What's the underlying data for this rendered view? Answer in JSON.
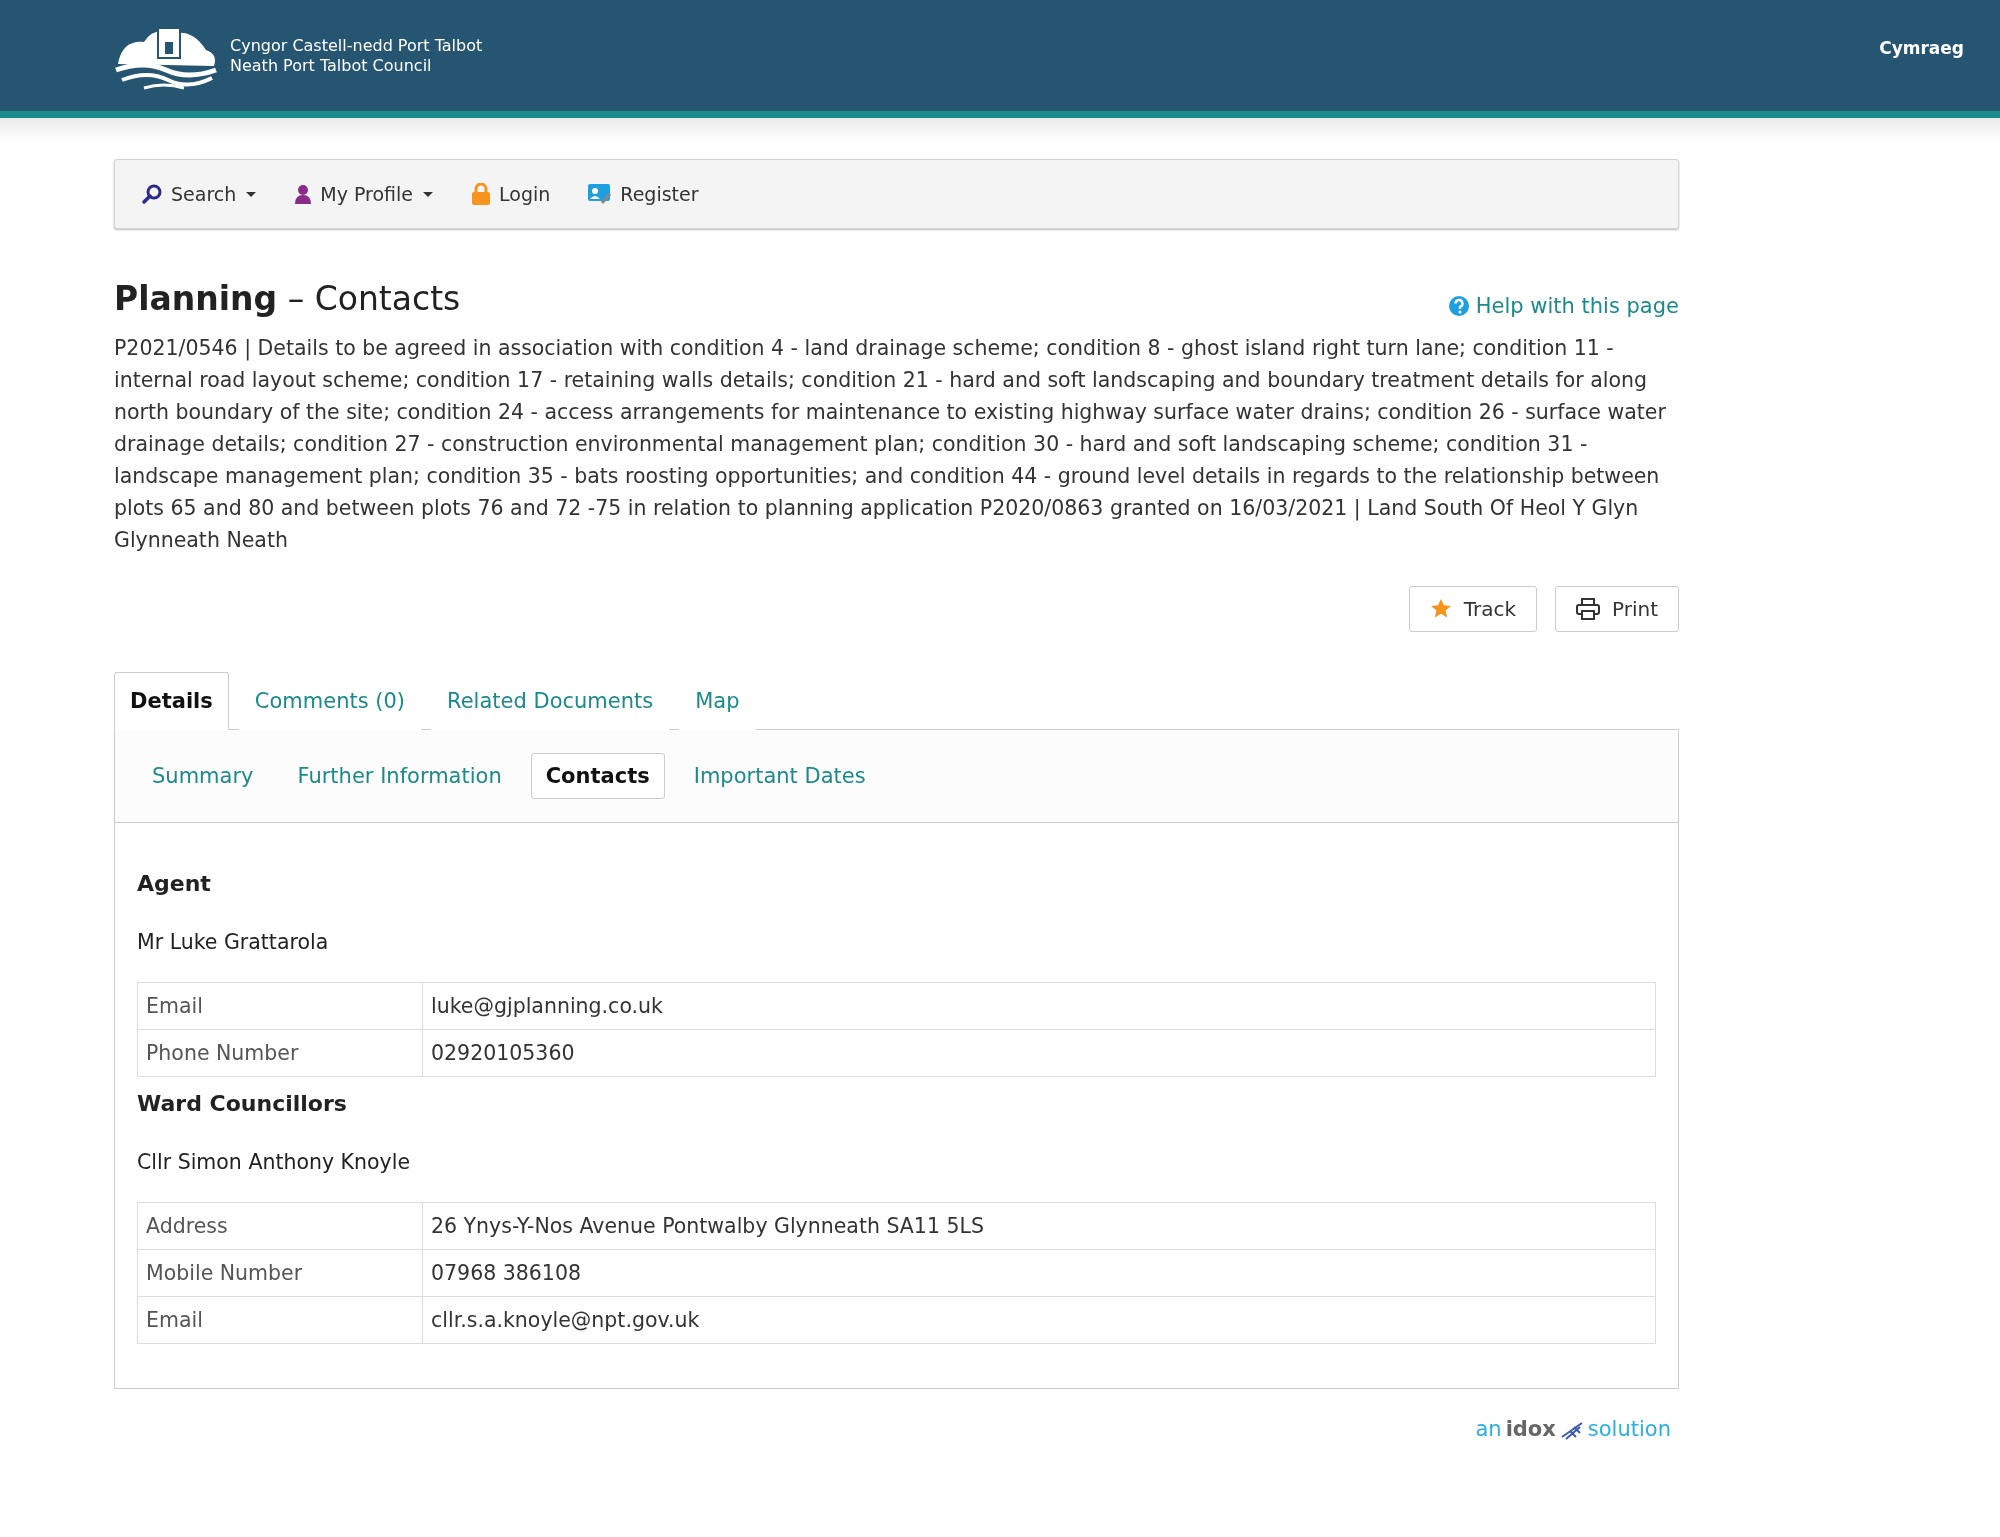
{
  "header": {
    "council_lines": [
      "Cyngor Castell-nedd Port Talbot",
      "Neath Port Talbot Council"
    ],
    "language_link": "Cymraeg"
  },
  "nav": [
    {
      "kind": "search",
      "label": "Search",
      "dropdown": true
    },
    {
      "kind": "profile",
      "label": "My Profile",
      "dropdown": true
    },
    {
      "kind": "login",
      "label": "Login",
      "dropdown": false
    },
    {
      "kind": "register",
      "label": "Register",
      "dropdown": false
    }
  ],
  "page": {
    "title_bold": "Planning",
    "title_rest": "– Contacts",
    "help_link": "Help with this page",
    "description": "P2021/0546 | Details to be agreed in association with condition 4 - land drainage scheme; condition 8 - ghost island right turn lane; condition 11 - internal road layout scheme; condition 17 - retaining walls details; condition 21 - hard and soft landscaping and boundary treatment details for along north boundary of the site; condition 24 - access arrangements for maintenance to existing highway surface water drains; condition 26 - surface water drainage details; condition 27 - construction environmental management plan; condition 30 - hard and soft landscaping scheme; condition 31 - landscape management plan; condition 35 - bats roosting opportunities; and condition 44 - ground level details in regards to the relationship between plots 65 and 80 and between plots 76 and 72 -75 in relation to planning application P2020/0863 granted on 16/03/2021 | Land South Of Heol Y Glyn Glynneath Neath"
  },
  "actions": [
    {
      "kind": "track",
      "label": "Track"
    },
    {
      "kind": "print",
      "label": "Print"
    }
  ],
  "tabs": [
    {
      "label": "Details",
      "selected": true
    },
    {
      "label": "Comments (0)",
      "selected": false
    },
    {
      "label": "Related Documents",
      "selected": false
    },
    {
      "label": "Map",
      "selected": false
    }
  ],
  "subtabs": [
    {
      "label": "Summary",
      "selected": false
    },
    {
      "label": "Further Information",
      "selected": false
    },
    {
      "label": "Contacts",
      "selected": true
    },
    {
      "label": "Important Dates",
      "selected": false
    }
  ],
  "sections": [
    {
      "heading": "Agent",
      "name": "Mr Luke Grattarola",
      "rows": [
        {
          "label": "Email",
          "value": "luke@gjplanning.co.uk"
        },
        {
          "label": "Phone Number",
          "value": "02920105360"
        }
      ]
    },
    {
      "heading": "Ward Councillors",
      "name": "Cllr Simon Anthony Knoyle",
      "rows": [
        {
          "label": "Address",
          "value": "26 Ynys-Y-Nos Avenue Pontwalby Glynneath SA11 5LS"
        },
        {
          "label": "Mobile Number",
          "value": "07968 386108"
        },
        {
          "label": "Email",
          "value": "cllr.s.a.knoyle@npt.gov.uk"
        }
      ]
    }
  ],
  "footer": {
    "logo_words": [
      "an",
      "idox",
      "solution"
    ]
  }
}
